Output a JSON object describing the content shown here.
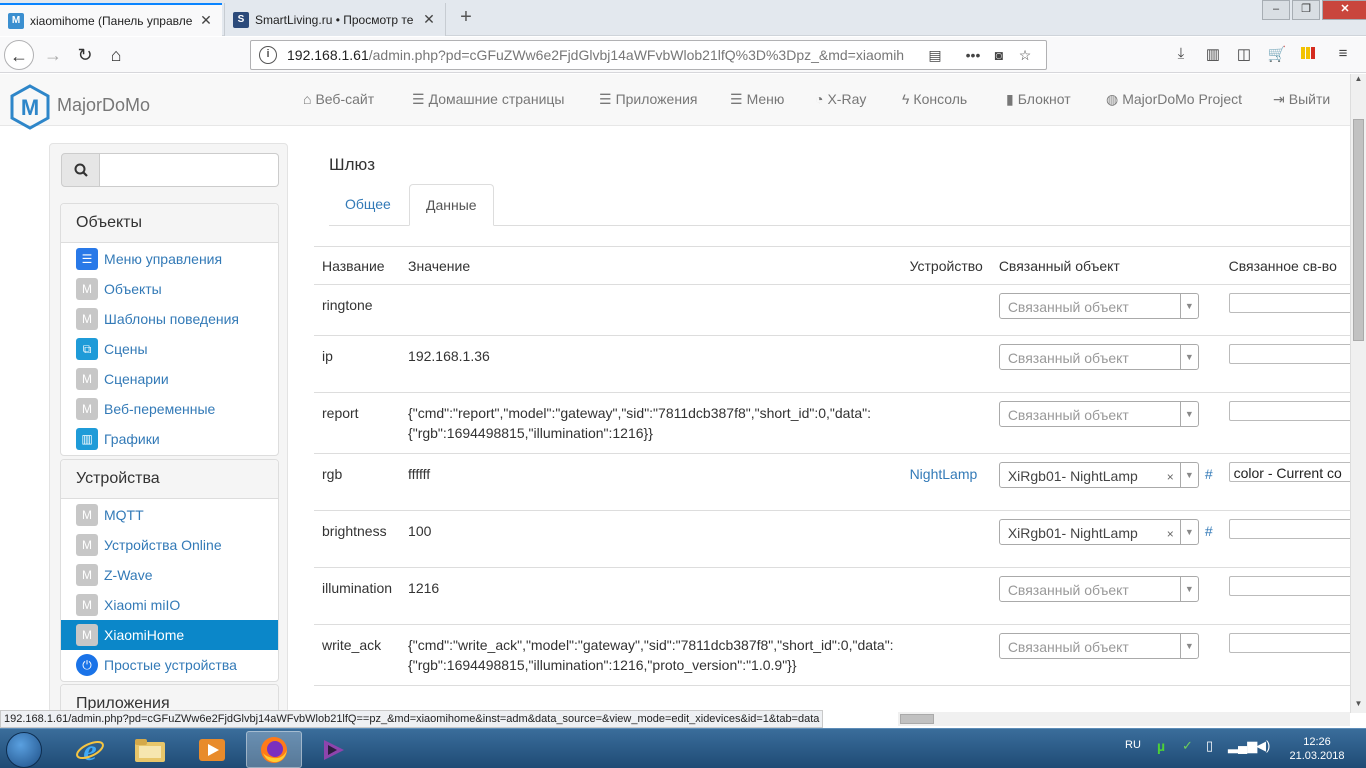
{
  "browser": {
    "tabs": [
      {
        "title": "xiaomihome (Панель управле",
        "active": true
      },
      {
        "title": "SmartLiving.ru • Просмотр те",
        "active": false
      }
    ],
    "url_host": "192.168.1.61",
    "url_path": "/admin.php?pd=cGFuZWw6e2FjdGlvbj14aWFvbWlob21lfQ%3D%3Dpz_&md=xiaomih",
    "status_url": "192.168.1.61/admin.php?pd=cGFuZWw6e2FjdGlvbj14aWFvbWlob21lfQ==pz_&md=xiaomihome&inst=adm&data_source=&view_mode=edit_xidevices&id=1&tab=data"
  },
  "site": {
    "brand": "MajorDoMo",
    "menu": [
      {
        "icon": "home-icon",
        "label": "Веб-сайт"
      },
      {
        "icon": "list-icon",
        "label": "Домашние страницы"
      },
      {
        "icon": "list-icon",
        "label": "Приложения"
      },
      {
        "icon": "list-icon",
        "label": "Меню"
      },
      {
        "icon": "dashboard-icon",
        "label": "X-Ray"
      },
      {
        "icon": "bolt-icon",
        "label": "Консоль"
      },
      {
        "icon": "book-icon",
        "label": "Блокнот"
      },
      {
        "icon": "globe-icon",
        "label": "MajorDoMo Project"
      },
      {
        "icon": "logout-icon",
        "label": "Выйти"
      }
    ]
  },
  "sidebar": {
    "search_placeholder": "",
    "objects_title": "Объекты",
    "objects": [
      {
        "label": "Меню управления",
        "icon": "menu-icon"
      },
      {
        "label": "Объекты",
        "icon": "m-icon"
      },
      {
        "label": "Шаблоны поведения",
        "icon": "m-icon"
      },
      {
        "label": "Сцены",
        "icon": "scenes-icon"
      },
      {
        "label": "Сценарии",
        "icon": "m-icon"
      },
      {
        "label": "Веб-переменные",
        "icon": "m-icon"
      },
      {
        "label": "Графики",
        "icon": "chart-icon"
      }
    ],
    "devices_title": "Устройства",
    "devices": [
      {
        "label": "MQTT",
        "icon": "m-icon"
      },
      {
        "label": "Устройства Online",
        "icon": "m-icon"
      },
      {
        "label": "Z-Wave",
        "icon": "m-icon"
      },
      {
        "label": "Xiaomi miIO",
        "icon": "m-icon"
      },
      {
        "label": "XiaomiHome",
        "icon": "m-icon"
      },
      {
        "label": "Простые устройства",
        "icon": "power-icon"
      }
    ],
    "apps_title": "Приложения"
  },
  "main": {
    "title": "Шлюз",
    "tabs": [
      "Общее",
      "Данные"
    ],
    "columns": [
      "Название",
      "Значение",
      "Устройство",
      "Связанный объект",
      "Связанное св-во"
    ],
    "select_placeholder": "Связанный объект",
    "rows": [
      {
        "name": "ringtone",
        "value": "",
        "device": "",
        "object": "",
        "property": ""
      },
      {
        "name": "ip",
        "value": "192.168.1.36",
        "device": "",
        "object": "",
        "property": ""
      },
      {
        "name": "report",
        "value": "{\"cmd\":\"report\",\"model\":\"gateway\",\"sid\":\"7811dcb387f8\",\"short_id\":0,\"data\": {\"rgb\":1694498815,\"illumination\":1216}}",
        "device": "",
        "object": "",
        "property": ""
      },
      {
        "name": "rgb",
        "value": "ffffff",
        "device": "NightLamp",
        "object": "XiRgb01- NightLamp",
        "property": "color - Current co"
      },
      {
        "name": "brightness",
        "value": "100",
        "device": "",
        "object": "XiRgb01- NightLamp",
        "property": ""
      },
      {
        "name": "illumination",
        "value": "1216",
        "device": "",
        "object": "",
        "property": ""
      },
      {
        "name": "write_ack",
        "value": "{\"cmd\":\"write_ack\",\"model\":\"gateway\",\"sid\":\"7811dcb387f8\",\"short_id\":0,\"data\": {\"rgb\":1694498815,\"illumination\":1216,\"proto_version\":\"1.0.9\"}}",
        "device": "",
        "object": "",
        "property": ""
      }
    ]
  },
  "taskbar": {
    "language": "RU",
    "time": "12:26",
    "date": "21.03.2018"
  },
  "colors": {
    "link": "#337ab7",
    "active_item": "#0b87c9",
    "firefox_accent": "#0a84ff"
  }
}
